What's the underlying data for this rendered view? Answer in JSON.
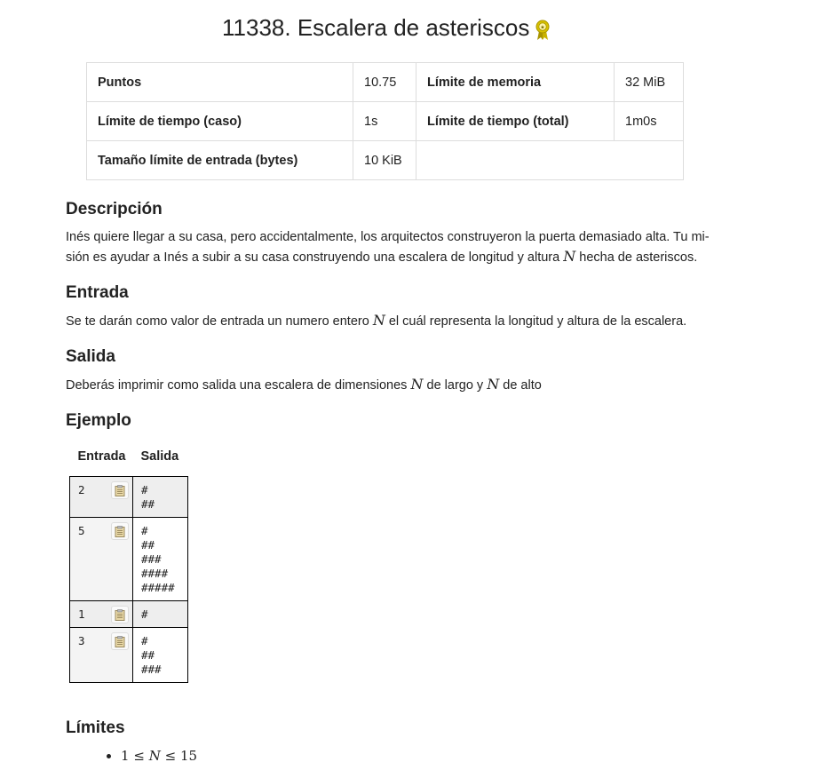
{
  "problem": {
    "title": "11338. Escalera de asteriscos"
  },
  "settings": {
    "points_label": "Puntos",
    "points_value": "10.75",
    "memory_label": "Límite de memoria",
    "memory_value": "32 MiB",
    "time_case_label": "Límite de tiempo (caso)",
    "time_case_value": "1s",
    "time_total_label": "Límite de tiempo (total)",
    "time_total_value": "1m0s",
    "input_size_label": "Tamaño límite de entrada (bytes)",
    "input_size_value": "10 KiB"
  },
  "description": {
    "heading": "Descripción",
    "line1": "Inés quiere llegar a su casa, pero accidentalmente, los arquitectos construyeron la puerta demasiado alta. Tu mi-",
    "line2_before": "sión es ayudar a Inés a subir a su casa construyendo una escalera de longitud y altura",
    "var": "N",
    "line2_after": "hecha de asteriscos."
  },
  "input": {
    "heading": "Entrada",
    "before": "Se te darán como valor de entrada un numero entero",
    "after": "el cuál representa la longitud y altura de la escalera."
  },
  "output": {
    "heading": "Salida",
    "before": "Deberás imprimir como salida una escalera de dimensiones",
    "middle": "de largo y",
    "after": "de alto"
  },
  "examples": {
    "heading": "Ejemplo",
    "col_input": "Entrada",
    "col_output": "Salida",
    "cases": [
      {
        "input": "2",
        "output": "#\n##"
      },
      {
        "input": "5",
        "output": "#\n##\n###\n####\n#####"
      },
      {
        "input": "1",
        "output": "#"
      },
      {
        "input": "3",
        "output": "#\n##\n###"
      }
    ]
  },
  "limits": {
    "heading": "Límites",
    "items": [
      {
        "lhs": "1",
        "op1": "≤",
        "var": "N",
        "op2": "≤",
        "rhs": "15"
      }
    ]
  },
  "icons": {
    "award": "award-ribbon-icon",
    "copy": "clipboard-icon"
  },
  "colors": {
    "award_gold": "#c9b200",
    "border": "#dddddd",
    "text": "#222222"
  }
}
